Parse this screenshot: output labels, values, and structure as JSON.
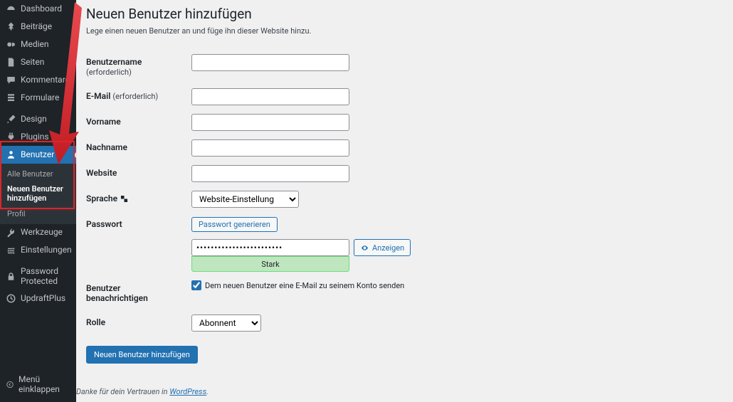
{
  "sidebar": {
    "items": [
      {
        "label": "Dashboard",
        "icon": "dashboard"
      },
      {
        "label": "Beiträge",
        "icon": "pin"
      },
      {
        "label": "Medien",
        "icon": "media"
      },
      {
        "label": "Seiten",
        "icon": "page"
      },
      {
        "label": "Kommentare",
        "icon": "comment"
      },
      {
        "label": "Formulare",
        "icon": "form"
      },
      {
        "label": "Design",
        "icon": "brush"
      },
      {
        "label": "Plugins",
        "icon": "plugin"
      },
      {
        "label": "Benutzer",
        "icon": "user",
        "current": true
      },
      {
        "label": "Werkzeuge",
        "icon": "tool"
      },
      {
        "label": "Einstellungen",
        "icon": "settings"
      },
      {
        "label": "Password Protected",
        "icon": "lock"
      },
      {
        "label": "UpdraftPlus",
        "icon": "updraft"
      }
    ],
    "sub": [
      {
        "label": "Alle Benutzer"
      },
      {
        "label": "Neuen Benutzer hinzufügen",
        "current": true
      },
      {
        "label": "Profil"
      }
    ],
    "collapse": "Menü einklappen"
  },
  "page": {
    "title": "Neuen Benutzer hinzufügen",
    "description": "Lege einen neuen Benutzer an und füge ihn dieser Website hinzu."
  },
  "form": {
    "username": {
      "label": "Benutzername",
      "required": "(erforderlich)"
    },
    "email": {
      "label": "E-Mail",
      "required": "(erforderlich)"
    },
    "first": {
      "label": "Vorname"
    },
    "last": {
      "label": "Nachname"
    },
    "website": {
      "label": "Website"
    },
    "lang": {
      "label": "Sprache",
      "options": [
        "Website-Einstellung"
      ],
      "selected": "Website-Einstellung"
    },
    "password": {
      "label": "Passwort",
      "generate": "Passwort generieren",
      "mask": "••••••••••••••••••••••••",
      "strength": "Stark",
      "show": "Anzeigen"
    },
    "notify": {
      "label": "Benutzer benachrichtigen",
      "text": "Dem neuen Benutzer eine E-Mail zu seinem Konto senden",
      "checked": true
    },
    "role": {
      "label": "Rolle",
      "options": [
        "Abonnent"
      ],
      "selected": "Abonnent"
    },
    "submit": "Neuen Benutzer hinzufügen"
  },
  "footer": {
    "text": "Danke für dein Vertrauen in ",
    "link": "WordPress"
  }
}
